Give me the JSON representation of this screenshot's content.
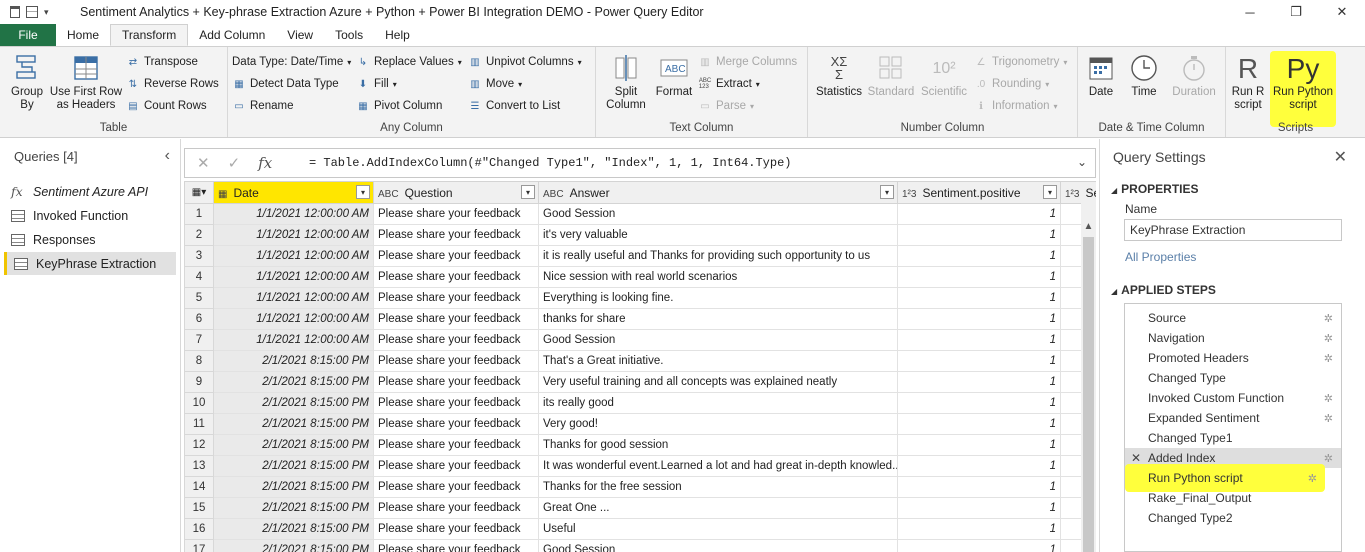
{
  "window": {
    "title": "Sentiment Analytics + Key-phrase Extraction Azure + Python + Power BI Integration DEMO - Power Query Editor",
    "controls": [
      "─",
      "❐",
      "✕"
    ]
  },
  "tabs": [
    "File",
    "Home",
    "Transform",
    "Add Column",
    "View",
    "Tools",
    "Help"
  ],
  "active_tab": "Transform",
  "ribbon": {
    "table": {
      "label": "Table",
      "group_by": "Group\nBy",
      "use_first_row": "Use First Row\nas Headers",
      "transpose": "Transpose",
      "reverse_rows": "Reverse Rows",
      "count_rows": "Count Rows"
    },
    "any_column": {
      "label": "Any Column",
      "data_type": "Data Type: Date/Time",
      "detect_data_type": "Detect Data Type",
      "rename": "Rename",
      "replace_values": "Replace Values",
      "fill": "Fill",
      "pivot_column": "Pivot Column",
      "unpivot_columns": "Unpivot Columns",
      "move": "Move",
      "convert_to_list": "Convert to List"
    },
    "text_column": {
      "label": "Text Column",
      "split_column": "Split\nColumn",
      "format": "Format",
      "merge_columns": "Merge Columns",
      "extract": "Extract",
      "parse": "Parse",
      "icon_abc123": "ABC\n123"
    },
    "number_column": {
      "label": "Number Column",
      "statistics": "Statistics",
      "standard": "Standard",
      "scientific": "Scientific",
      "trigonometry": "Trigonometry",
      "rounding": "Rounding",
      "information": "Information",
      "icon_sigma": "XΣ\nΣ",
      "icon_exp": "10²"
    },
    "date_time": {
      "label": "Date & Time Column",
      "date": "Date",
      "time": "Time",
      "duration": "Duration"
    },
    "scripts": {
      "label": "Scripts",
      "run_r": "Run R\nscript",
      "run_python": "Run Python\nscript",
      "icon_r": "R",
      "icon_py": "Py"
    }
  },
  "queries": {
    "header": "Queries [4]",
    "items": [
      {
        "name": "Sentiment Azure API",
        "icon": "fx-icon",
        "style": "italic"
      },
      {
        "name": "Invoked Function",
        "icon": "table-icon"
      },
      {
        "name": "Responses",
        "icon": "table-icon"
      },
      {
        "name": "KeyPhrase Extraction",
        "icon": "table-icon",
        "selected": true
      }
    ]
  },
  "formula": {
    "fx": "fx",
    "text": "= Table.AddIndexColumn(#\"Changed Type1\", \"Index\", 1, 1, Int64.Type)"
  },
  "grid": {
    "columns": [
      {
        "name": "Date",
        "type": "📅"
      },
      {
        "name": "Question",
        "type": "A B C"
      },
      {
        "name": "Answer",
        "type": "A B C"
      },
      {
        "name": "Sentiment.positive",
        "type": "1 2 3"
      },
      {
        "name": "Se",
        "type": "1 2 3"
      }
    ],
    "rows": [
      {
        "i": "1",
        "date": "1/1/2021 12:00:00 AM",
        "q": "Please share your feedback",
        "a": "Good Session",
        "p": "1"
      },
      {
        "i": "2",
        "date": "1/1/2021 12:00:00 AM",
        "q": "Please share your feedback",
        "a": "it's very valuable",
        "p": "1"
      },
      {
        "i": "3",
        "date": "1/1/2021 12:00:00 AM",
        "q": "Please share your feedback",
        "a": "it is really useful and Thanks for providing such opportunity to us",
        "p": "1"
      },
      {
        "i": "4",
        "date": "1/1/2021 12:00:00 AM",
        "q": "Please share your feedback",
        "a": "Nice session with real world scenarios",
        "p": "1"
      },
      {
        "i": "5",
        "date": "1/1/2021 12:00:00 AM",
        "q": "Please share your feedback",
        "a": "Everything is looking fine.",
        "p": "1"
      },
      {
        "i": "6",
        "date": "1/1/2021 12:00:00 AM",
        "q": "Please share your feedback",
        "a": "thanks for share",
        "p": "1"
      },
      {
        "i": "7",
        "date": "1/1/2021 12:00:00 AM",
        "q": "Please share your feedback",
        "a": "Good Session",
        "p": "1"
      },
      {
        "i": "8",
        "date": "2/1/2021 8:15:00 PM",
        "q": "Please share your feedback",
        "a": "That's a Great initiative.",
        "p": "1"
      },
      {
        "i": "9",
        "date": "2/1/2021 8:15:00 PM",
        "q": "Please share your feedback",
        "a": "Very useful training and all concepts was explained neatly",
        "p": "1"
      },
      {
        "i": "10",
        "date": "2/1/2021 8:15:00 PM",
        "q": "Please share your feedback",
        "a": "its really good",
        "p": "1"
      },
      {
        "i": "11",
        "date": "2/1/2021 8:15:00 PM",
        "q": "Please share your feedback",
        "a": "Very good!",
        "p": "1"
      },
      {
        "i": "12",
        "date": "2/1/2021 8:15:00 PM",
        "q": "Please share your feedback",
        "a": "Thanks for good session",
        "p": "1"
      },
      {
        "i": "13",
        "date": "2/1/2021 8:15:00 PM",
        "q": "Please share your feedback",
        "a": "It was wonderful event.Learned a lot and had great in-depth knowled...",
        "p": "1"
      },
      {
        "i": "14",
        "date": "2/1/2021 8:15:00 PM",
        "q": "Please share your feedback",
        "a": "Thanks for the free session",
        "p": "1"
      },
      {
        "i": "15",
        "date": "2/1/2021 8:15:00 PM",
        "q": "Please share your feedback",
        "a": "Great One ...",
        "p": "1"
      },
      {
        "i": "16",
        "date": "2/1/2021 8:15:00 PM",
        "q": "Please share your feedback",
        "a": "Useful",
        "p": "1"
      },
      {
        "i": "17",
        "date": "2/1/2021 8:15:00 PM",
        "q": "Please share your feedback",
        "a": "Good Session",
        "p": "1"
      }
    ]
  },
  "settings": {
    "header": "Query Settings",
    "properties": "PROPERTIES",
    "name_label": "Name",
    "name_value": "KeyPhrase Extraction",
    "all_properties": "All Properties",
    "applied_steps": "APPLIED STEPS",
    "steps": [
      {
        "name": "Source",
        "gear": true
      },
      {
        "name": "Navigation",
        "gear": true
      },
      {
        "name": "Promoted Headers",
        "gear": true
      },
      {
        "name": "Changed Type",
        "gear": false
      },
      {
        "name": "Invoked Custom Function",
        "gear": true
      },
      {
        "name": "Expanded Sentiment",
        "gear": true
      },
      {
        "name": "Changed Type1",
        "gear": false
      },
      {
        "name": "Added Index",
        "gear": true,
        "selected": true
      },
      {
        "name": "Run Python script",
        "gear": true,
        "highlight": true
      },
      {
        "name": "Rake_Final_Output",
        "gear": false
      },
      {
        "name": "Changed Type2",
        "gear": false
      }
    ]
  },
  "colors": {
    "accent_green": "#217346",
    "highlight": "#ffff3c",
    "date_header": "#ffe600"
  }
}
